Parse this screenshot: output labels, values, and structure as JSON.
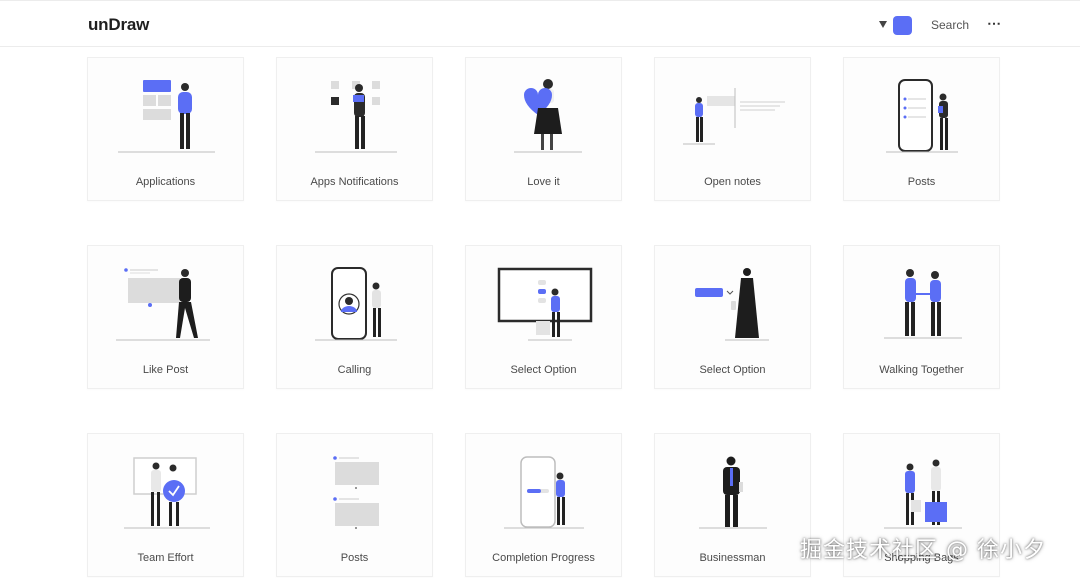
{
  "header": {
    "logo": "unDraw",
    "accent_color": "#5b6ef5",
    "search_label": "Search",
    "more_icon": "⋯"
  },
  "cards": [
    {
      "label": "Applications",
      "illustration": "applications"
    },
    {
      "label": "Apps Notifications",
      "illustration": "apps-notifications"
    },
    {
      "label": "Love it",
      "illustration": "love-it"
    },
    {
      "label": "Open notes",
      "illustration": "open-notes"
    },
    {
      "label": "Posts",
      "illustration": "posts-phone"
    },
    {
      "label": "Like Post",
      "illustration": "like-post"
    },
    {
      "label": "Calling",
      "illustration": "calling"
    },
    {
      "label": "Select Option",
      "illustration": "select-option-monitor"
    },
    {
      "label": "Select Option",
      "illustration": "select-option-dropdown"
    },
    {
      "label": "Walking Together",
      "illustration": "walking-together"
    },
    {
      "label": "Team Effort",
      "illustration": "team-effort"
    },
    {
      "label": "Posts",
      "illustration": "posts-feed"
    },
    {
      "label": "Completion Progress",
      "illustration": "completion-progress"
    },
    {
      "label": "Businessman",
      "illustration": "businessman"
    },
    {
      "label": "Shopping Bags",
      "illustration": "shopping-bags"
    }
  ],
  "watermark": "掘金技术社区 @ 徐小夕"
}
